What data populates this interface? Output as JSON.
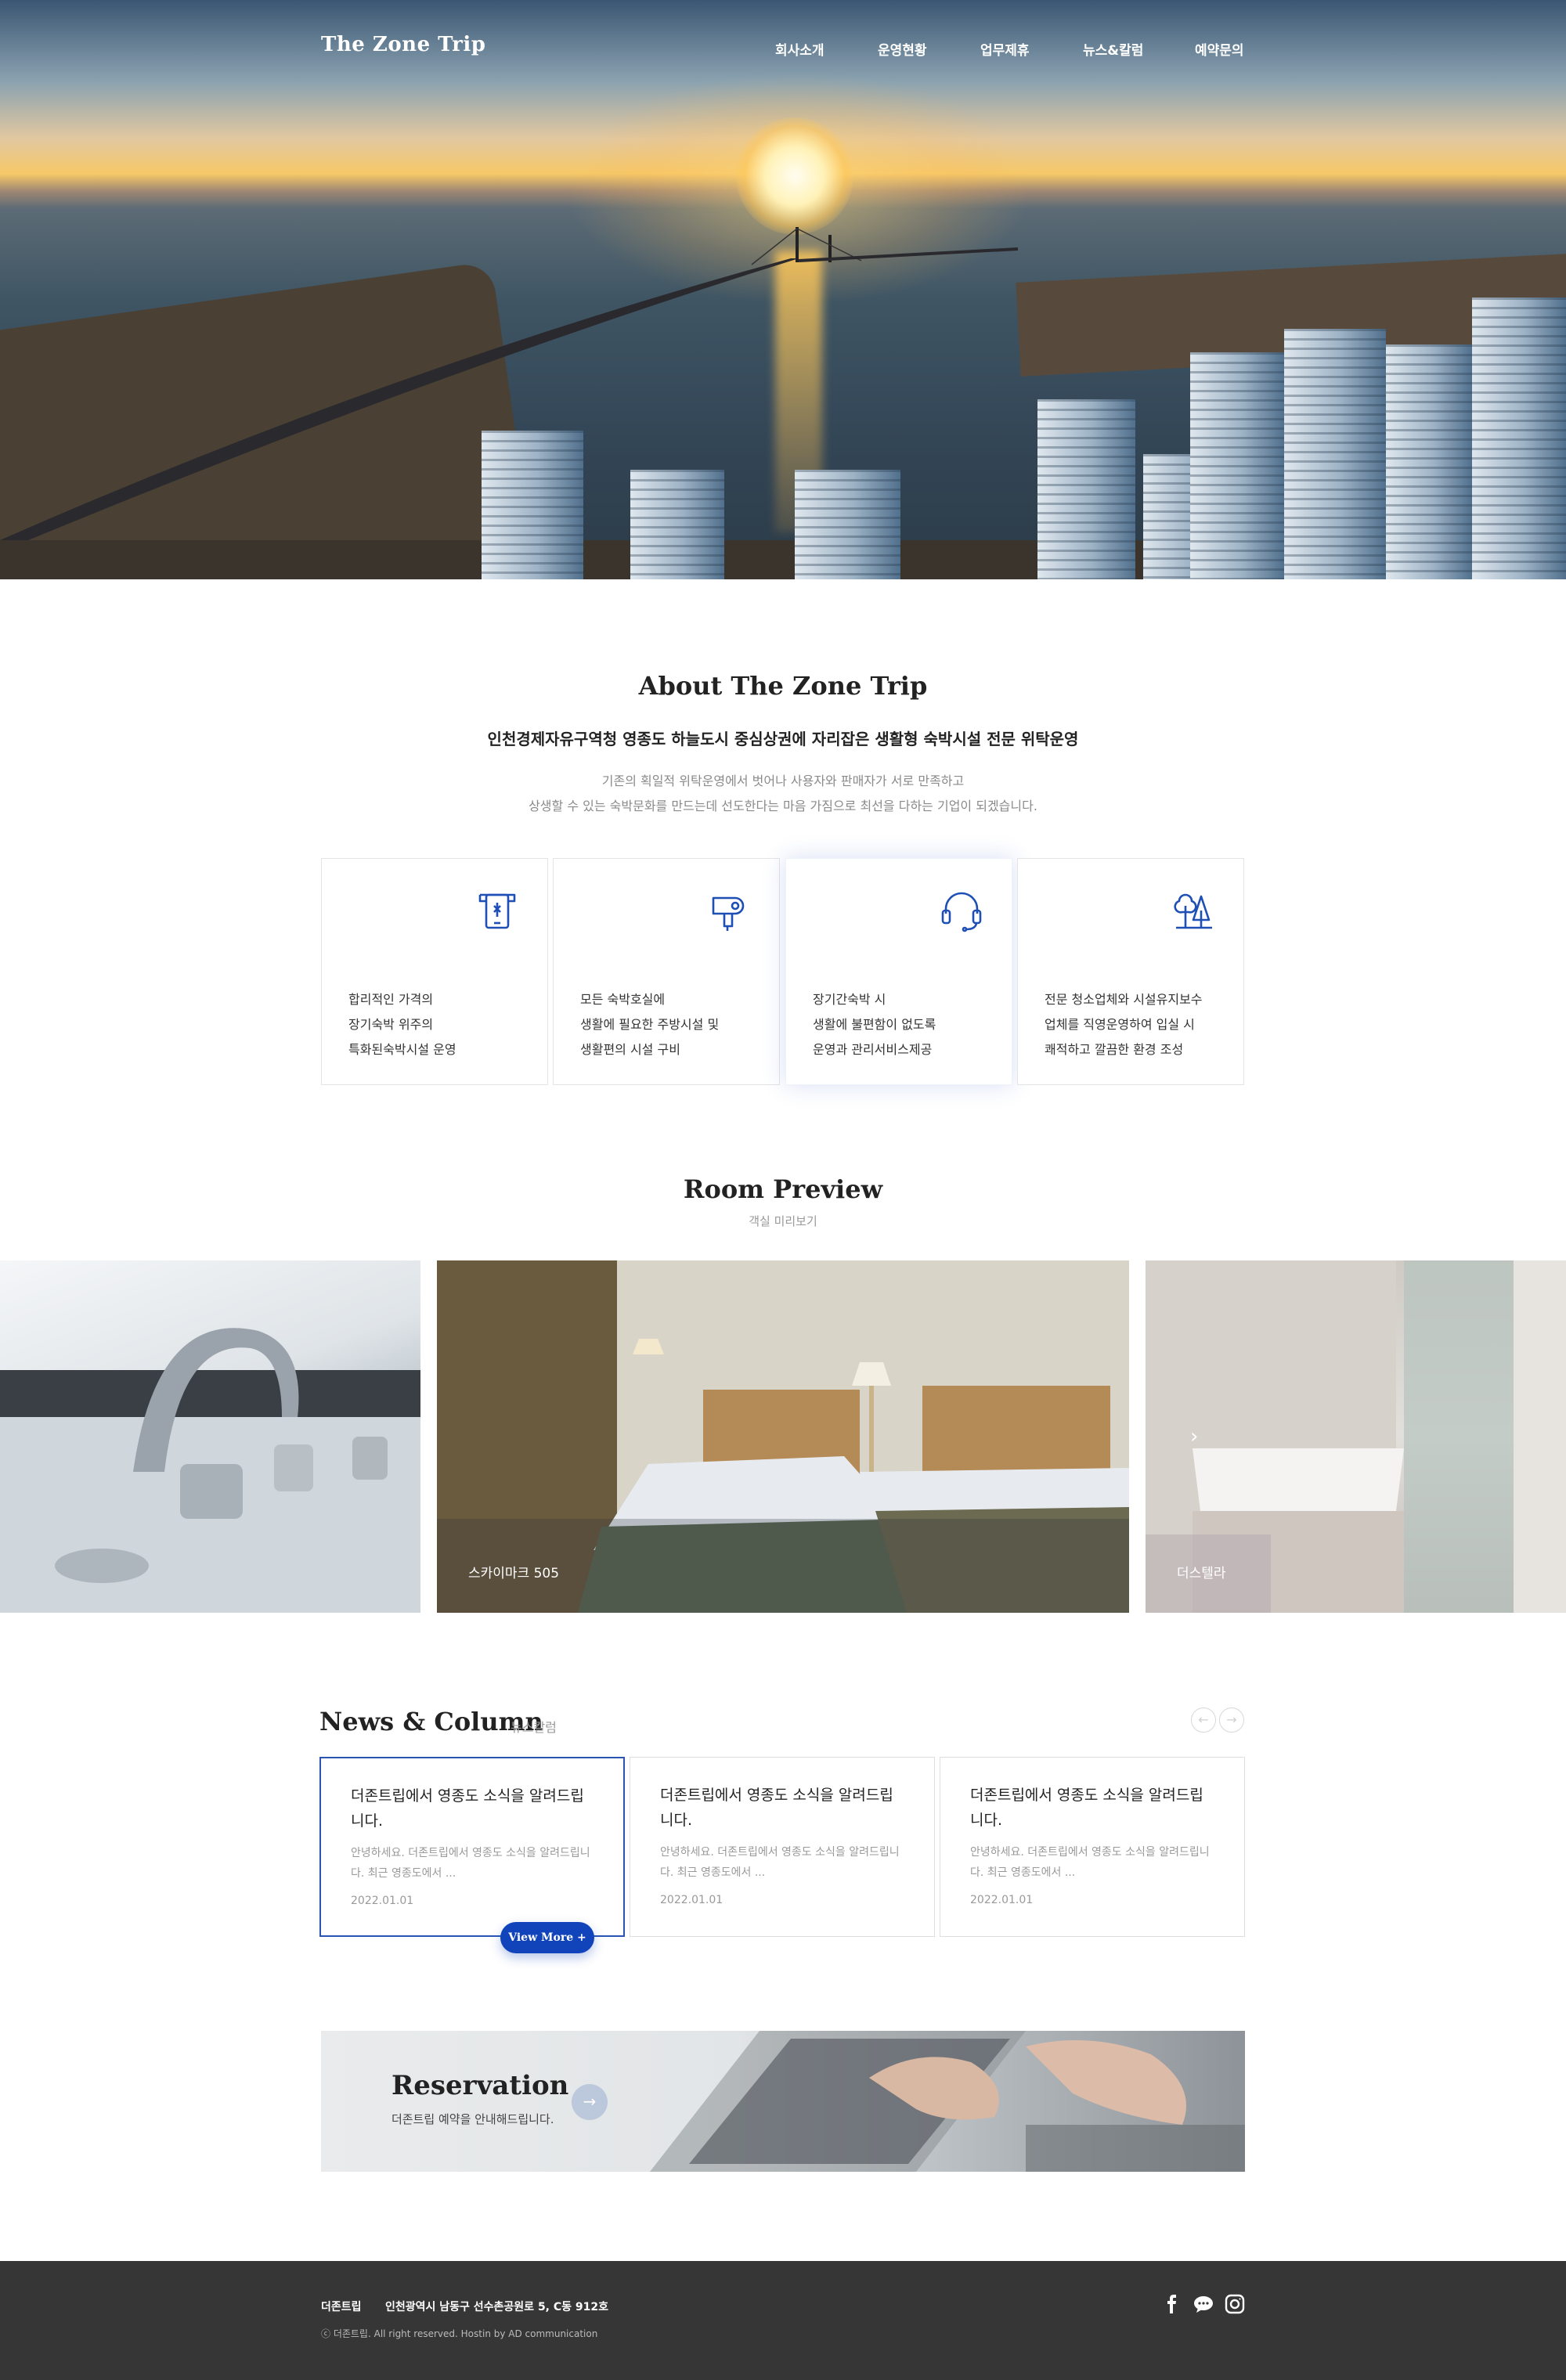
{
  "header": {
    "logo": "The Zone Trip",
    "menu": [
      "회사소개",
      "운영현황",
      "업무제휴",
      "뉴스&칼럼",
      "예약문의"
    ]
  },
  "about": {
    "title": "About The Zone Trip",
    "subtitle": "인천경제자유구역청 영종도 하늘도시 중심상권에 자리잡은 생활형 숙박시설 전문 위탁운영",
    "desc_line1": "기존의 획일적 위탁운영에서 벗어나 사용자와 판매자가 서로 만족하고",
    "desc_line2": "상생할 수 있는 숙박문화를 만드는데 선도한다는 마음 가짐으로 최선을 다하는 기업이 되겠습니다.",
    "features": [
      {
        "icon": "phone-tag-icon",
        "lines": [
          "합리적인 가격의",
          "장기숙박 위주의",
          "특화된숙박시설 운영"
        ]
      },
      {
        "icon": "hair-dryer-icon",
        "lines": [
          "모든 숙박호실에",
          "생활에 필요한 주방시설 및",
          "생활편의 시설 구비"
        ]
      },
      {
        "icon": "headset-icon",
        "lines": [
          "장기간숙박 시",
          "생활에 불편함이 없도록",
          "운영과 관리서비스제공"
        ]
      },
      {
        "icon": "trees-icon",
        "lines": [
          "전문 청소업체와 시설유지보수",
          "업체를 직영운영하여 입실 시",
          "쾌적하고 깔끔한 환경 조성"
        ]
      }
    ]
  },
  "rooms": {
    "title": "Room Preview",
    "subtitle": "객실 미리보기",
    "items": [
      {
        "label": ""
      },
      {
        "label": "스카이마크 505"
      },
      {
        "label": "더스텔라"
      }
    ]
  },
  "news": {
    "title": "News & Column",
    "subtitle": "뉴스칼럼",
    "prev_icon": "←",
    "next_icon": "→",
    "items": [
      {
        "title": "더존트립에서 영종도 소식을 알려드립니다.",
        "desc": "안녕하세요. 더존트립에서 영종도 소식을 알려드립니다. 최근 영종도에서 ...",
        "date": "2022.01.01"
      },
      {
        "title": "더존트립에서 영종도 소식을 알려드립니다.",
        "desc": "안녕하세요. 더존트립에서 영종도 소식을 알려드립니다. 최근 영종도에서 ...",
        "date": "2022.01.01"
      },
      {
        "title": "더존트립에서 영종도 소식을 알려드립니다.",
        "desc": "안녕하세요. 더존트립에서 영종도 소식을 알려드립니다. 최근 영종도에서 ...",
        "date": "2022.01.01"
      }
    ],
    "view_more": "View More +"
  },
  "reservation": {
    "title": "Reservation",
    "subtitle": "더존트립 예약을 안내해드립니다.",
    "arrow": "→"
  },
  "footer": {
    "company": "더존트립",
    "address": "인천광역시 남동구 선수촌공원로 5, C동 912호",
    "copyright": "ⓒ 더존트립. All right reserved. Hostin by AD communication",
    "social": [
      "facebook-icon",
      "chat-icon",
      "instagram-icon"
    ]
  },
  "colors": {
    "accent": "#1144bb",
    "icon_blue": "#1e4fb5",
    "footer_bg": "#363636"
  }
}
